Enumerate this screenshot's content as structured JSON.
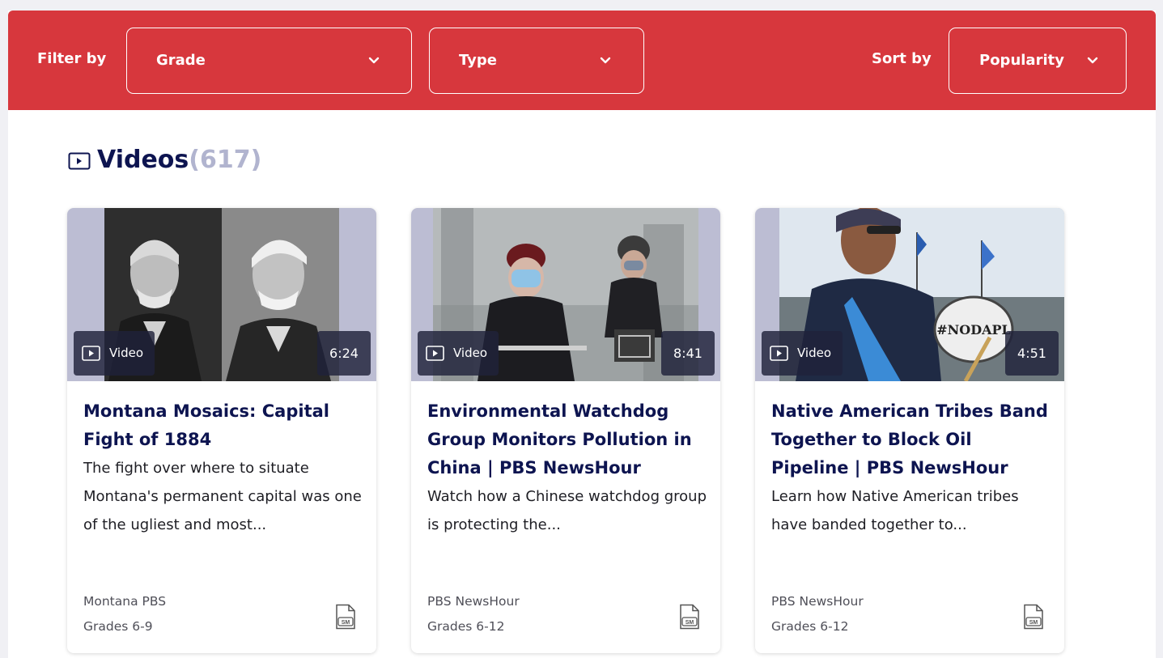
{
  "filter_bar": {
    "filter_label": "Filter by",
    "grade_dropdown": "Grade",
    "type_dropdown": "Type",
    "sort_label": "Sort by",
    "sort_dropdown": "Popularity",
    "background_color": "#d7373d"
  },
  "section": {
    "title": "Videos",
    "count": "(617)"
  },
  "cards": [
    {
      "type_label": "Video",
      "duration": "6:24",
      "title": "Montana Mosaics: Capital Fight of 1884",
      "description": "The fight over where to situate Montana's permanent capital was one of the ugliest and most...",
      "source": "Montana PBS",
      "grades": "Grades 6-9",
      "badge_icon": "sm-document-icon"
    },
    {
      "type_label": "Video",
      "duration": "8:41",
      "title": "Environmental Watchdog Group Monitors Pollution in China | PBS NewsHour",
      "description": "Watch how a Chinese watchdog group is protecting the...",
      "source": "PBS NewsHour",
      "grades": "Grades 6-12",
      "badge_icon": "sm-document-icon"
    },
    {
      "type_label": "Video",
      "duration": "4:51",
      "title": "Native American Tribes Band Together to Block Oil Pipeline | PBS NewsHour",
      "description": "Learn how Native American tribes have banded together to...",
      "source": "PBS NewsHour",
      "grades": "Grades 6-12",
      "badge_icon": "sm-document-icon"
    }
  ]
}
